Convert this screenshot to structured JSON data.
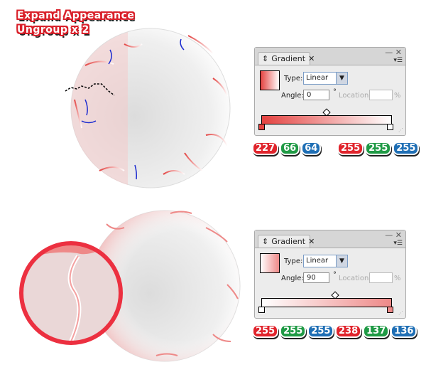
{
  "captions": [
    "Expand Appearance",
    "Ungroup x 2"
  ],
  "panels": [
    {
      "tab": "Gradient",
      "type_label": "Type:",
      "type_value": "Linear",
      "angle_label": "Angle:",
      "angle_value": "0",
      "degree": "°",
      "location_label": "Location:",
      "location_value": "",
      "percent": "%",
      "gradient": {
        "start": "#e34240",
        "end": "#ffffff"
      },
      "start_rgb": [
        "227",
        "66",
        "64"
      ],
      "end_rgb": [
        "255",
        "255",
        "255"
      ]
    },
    {
      "tab": "Gradient",
      "type_label": "Type:",
      "type_value": "Linear",
      "angle_label": "Angle:",
      "angle_value": "90",
      "degree": "°",
      "location_label": "Location:",
      "location_value": "",
      "percent": "%",
      "gradient": {
        "start": "#ffffff",
        "end": "#ee8988"
      },
      "start_rgb": [
        "255",
        "255",
        "255"
      ],
      "end_rgb": [
        "238",
        "137",
        "136"
      ]
    }
  ],
  "icons": {
    "tab_arrows": "updown-arrows-icon",
    "close": "close-icon",
    "minimize": "minimize-icon",
    "menu": "panel-menu-icon",
    "dropdown": "chevron-down-icon"
  }
}
